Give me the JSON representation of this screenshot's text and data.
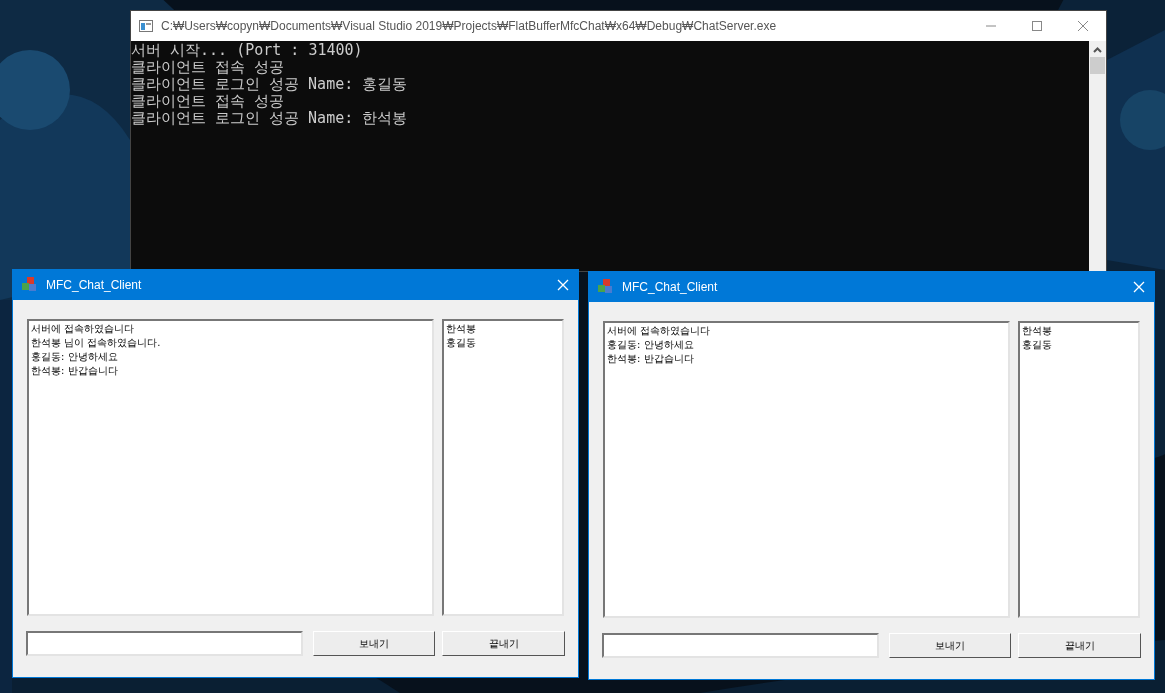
{
  "console": {
    "title": "C:₩Users₩copyn₩Documents₩Visual Studio 2019₩Projects₩FlatBufferMfcChat₩x64₩Debug₩ChatServer.exe",
    "lines": [
      "서버 시작... (Port : 31400)",
      "클라이언트 접속 성공",
      "클라이언트 로그인 성공 Name: 홍길동",
      "클라이언트 접속 성공",
      "클라이언트 로그인 성공 Name: 한석봉"
    ]
  },
  "clients": [
    {
      "title": "MFC_Chat_Client",
      "messages": [
        "서버에 접속하였습니다",
        "한석봉 님이 접속하였습니다.",
        "홍길동: 안녕하세요",
        "한석봉: 반갑습니다"
      ],
      "users": [
        "한석봉",
        "홍길동"
      ],
      "buttons": [
        "보내기",
        "끝내기"
      ]
    },
    {
      "title": "MFC_Chat_Client",
      "messages": [
        "서버에 접속하였습니다",
        "홍길동: 안녕하세요",
        "한석봉: 반갑습니다"
      ],
      "users": [
        "한석봉",
        "홍길동"
      ],
      "buttons": [
        "보내기",
        "끝내기"
      ]
    }
  ]
}
